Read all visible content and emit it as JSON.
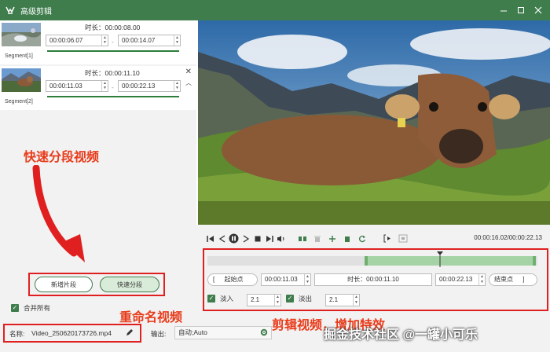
{
  "window": {
    "title": "高级剪辑"
  },
  "segments": [
    {
      "duration": "时长：00:00:08.00",
      "start": "00:00:06.07",
      "end": "00:00:14.07",
      "label": "Segment[1]"
    },
    {
      "duration": "时长：00:00:11.10",
      "start": "00:00:11.03",
      "end": "00:00:22.13",
      "label": "Segment[2]"
    }
  ],
  "annotations": {
    "split": "快速分段视频",
    "rename": "重命名视频",
    "edit": "剪辑视频，增加特效"
  },
  "buttons": {
    "add_segment": "新增片段",
    "quick_split": "快速分段"
  },
  "merge_all": "合并所有",
  "name_field": {
    "label": "名称:",
    "value": "Video_250620173726.mp4"
  },
  "output": {
    "label": "输出:",
    "value": "自动;Auto"
  },
  "player": {
    "time": "00:00:16.02/00:00:22.13"
  },
  "trim": {
    "start_label": "起始点",
    "start_value": "00:00:11.03",
    "duration_label": "时长：00:00:11.10",
    "end_value": "00:00:22.13",
    "end_label": "结束点"
  },
  "fade": {
    "in_label": "淡入",
    "in_value": "2.1",
    "out_label": "淡出",
    "out_value": "2.1"
  },
  "watermark": "掘金技术社区 @一罐小可乐",
  "colors": {
    "accent": "#3f7d4d",
    "annotation": "#e83b1a",
    "selection": "#a6d3a6"
  }
}
